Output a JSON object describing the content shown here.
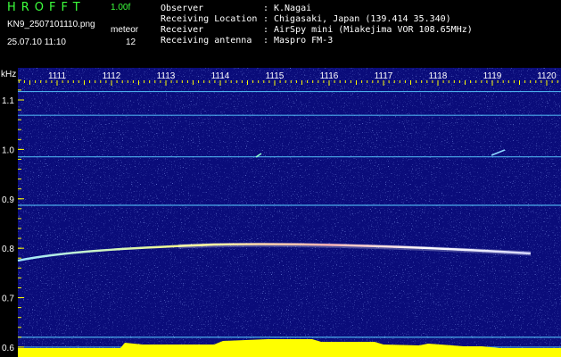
{
  "header": {
    "app_title": "HROFFT",
    "version": "1.00f",
    "filename": "KN9_2507101110.png",
    "mode": "meteor",
    "datetime": "25.07.10 11:10",
    "count": "12"
  },
  "meta": [
    {
      "label": "Observer",
      "sep": ":",
      "value": "K.Nagai"
    },
    {
      "label": "Receiving Location",
      "sep": ":",
      "value": "Chigasaki, Japan (139.414 35.340)"
    },
    {
      "label": "Receiver",
      "sep": ":",
      "value": "AirSpy mini (Miakejima VOR 108.65MHz)"
    },
    {
      "label": "Receiving antenna",
      "sep": ":",
      "value": "Maspro FM-3"
    }
  ],
  "spectrogram": {
    "y_unit": "kHz",
    "time_ticks": [
      "1111",
      "1112",
      "1113",
      "1114",
      "1115",
      "1116",
      "1117",
      "1118",
      "1119",
      "1120"
    ],
    "freq_ticks": [
      "1.1",
      "1.0",
      "0.9",
      "0.8",
      "0.7",
      "0.6"
    ],
    "freq_range": [
      0.58,
      1.165
    ],
    "carrier_lines": [
      1.117,
      1.069,
      0.985,
      0.887,
      0.62,
      0.6
    ],
    "colors": {
      "background": "#0a0c7a",
      "noise": "#4a6cff",
      "tick": "#ffff00",
      "carrier": "#56c8ff",
      "signal": "#ffff00",
      "level_high": "#ffff00",
      "level_low": "#00c8ff"
    }
  }
}
